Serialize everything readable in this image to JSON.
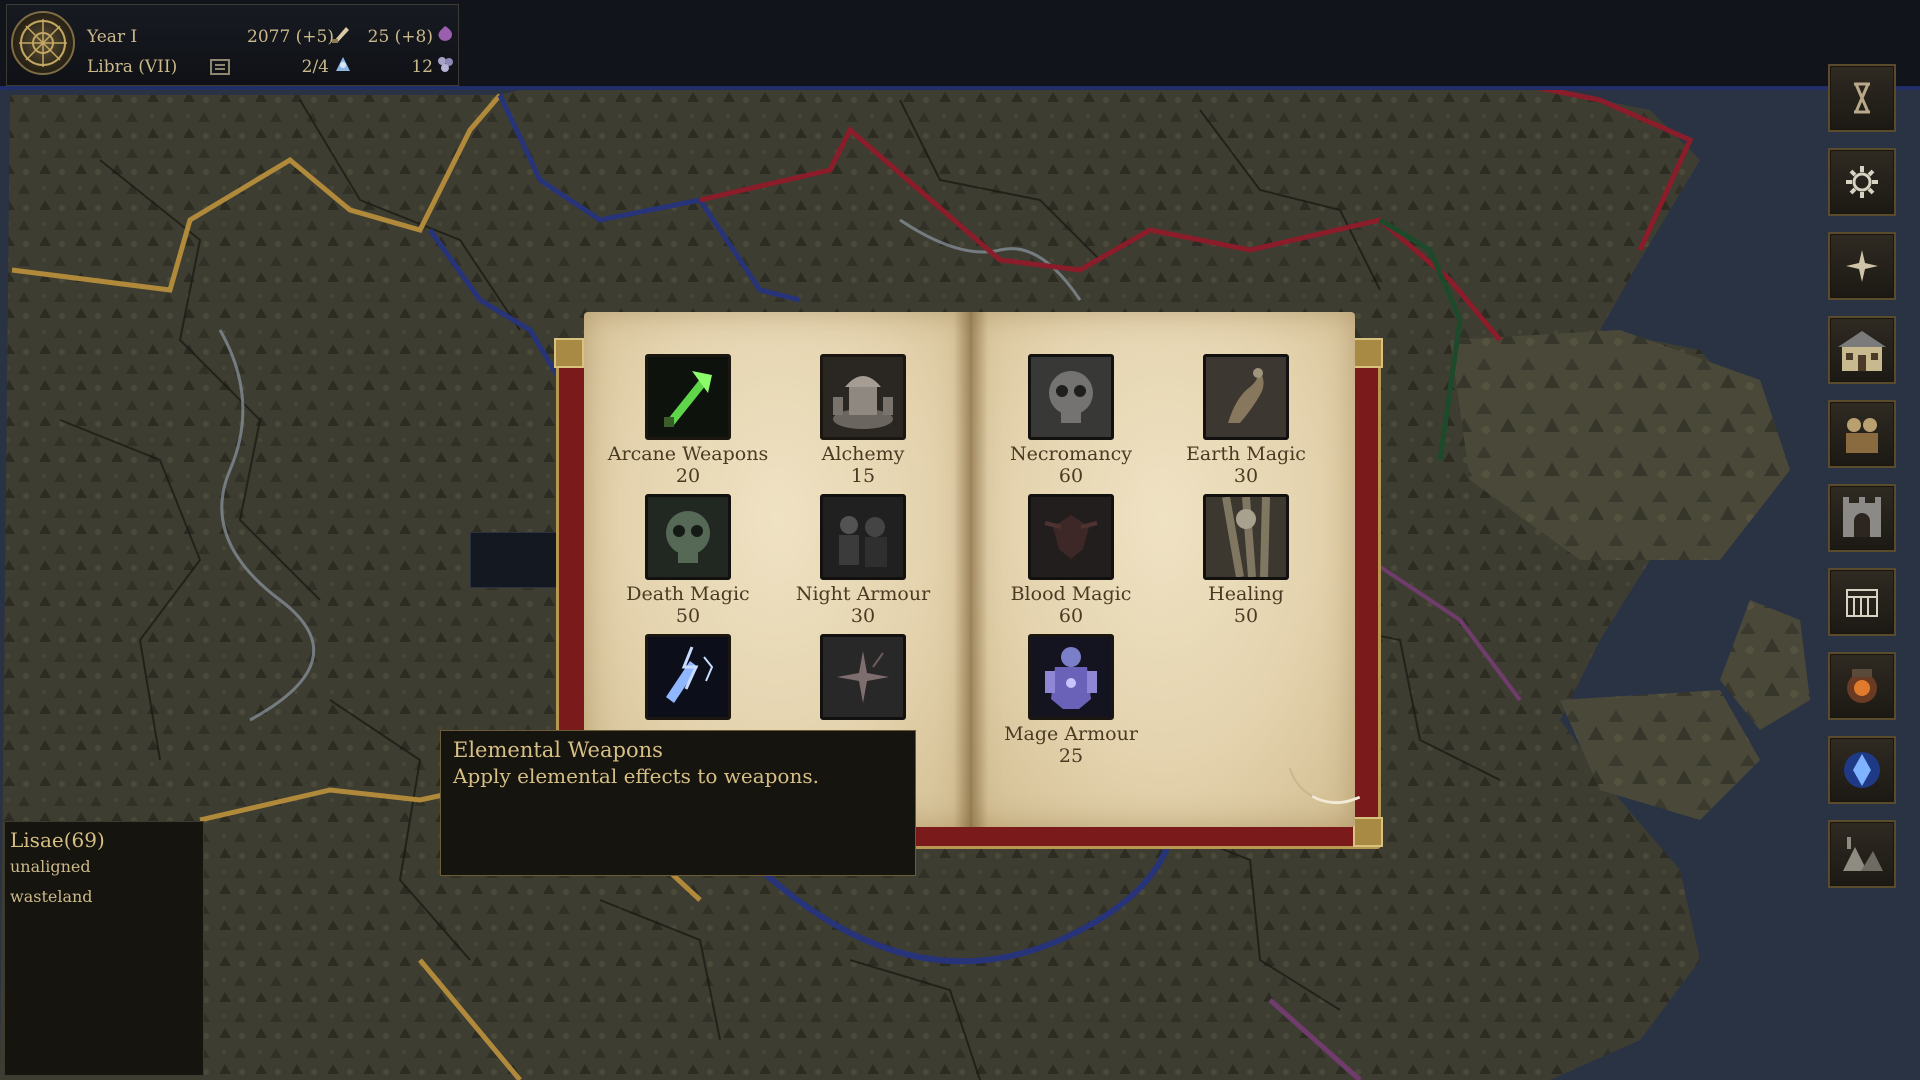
{
  "topbar": {
    "year": "Year I",
    "month": "Libra (VII)",
    "gold": "2077 (+5)",
    "mana": "25 (+8)",
    "units": "2/4",
    "gems": "12"
  },
  "sidebar": {
    "items": [
      {
        "icon": "hourglass-icon"
      },
      {
        "icon": "gear-icon"
      },
      {
        "icon": "compass-icon"
      },
      {
        "icon": "building-icon"
      },
      {
        "icon": "army-icon"
      },
      {
        "icon": "castle-gate-icon"
      },
      {
        "icon": "calendar-grid-icon"
      },
      {
        "icon": "forge-icon"
      },
      {
        "icon": "crystal-icon"
      },
      {
        "icon": "encampment-icon"
      }
    ]
  },
  "book": {
    "left_page": [
      {
        "name": "Arcane Weapons",
        "cost": "20",
        "icon": "arcane-weapons-icon"
      },
      {
        "name": "Alchemy",
        "cost": "15",
        "icon": "alchemy-icon"
      },
      {
        "name": "Death Magic",
        "cost": "50",
        "icon": "death-magic-icon"
      },
      {
        "name": "Night Armour",
        "cost": "30",
        "icon": "night-armour-icon"
      },
      {
        "name": "",
        "cost": "",
        "icon": "elemental-weapons-icon"
      },
      {
        "name": "",
        "cost": "",
        "icon": "spark-magic-icon"
      }
    ],
    "right_page": [
      {
        "name": "Necromancy",
        "cost": "60",
        "icon": "necromancy-icon"
      },
      {
        "name": "Earth Magic",
        "cost": "30",
        "icon": "earth-magic-icon"
      },
      {
        "name": "Blood Magic",
        "cost": "60",
        "icon": "blood-magic-icon"
      },
      {
        "name": "Healing",
        "cost": "50",
        "icon": "healing-icon"
      },
      {
        "name": "Mage Armour",
        "cost": "25",
        "icon": "mage-armour-icon"
      }
    ]
  },
  "tooltip": {
    "title": "Elemental Weapons",
    "description": "Apply elemental effects to weapons."
  },
  "region": {
    "title": "Lisae(69)",
    "alignment": "unaligned",
    "terrain": "wasteland"
  }
}
